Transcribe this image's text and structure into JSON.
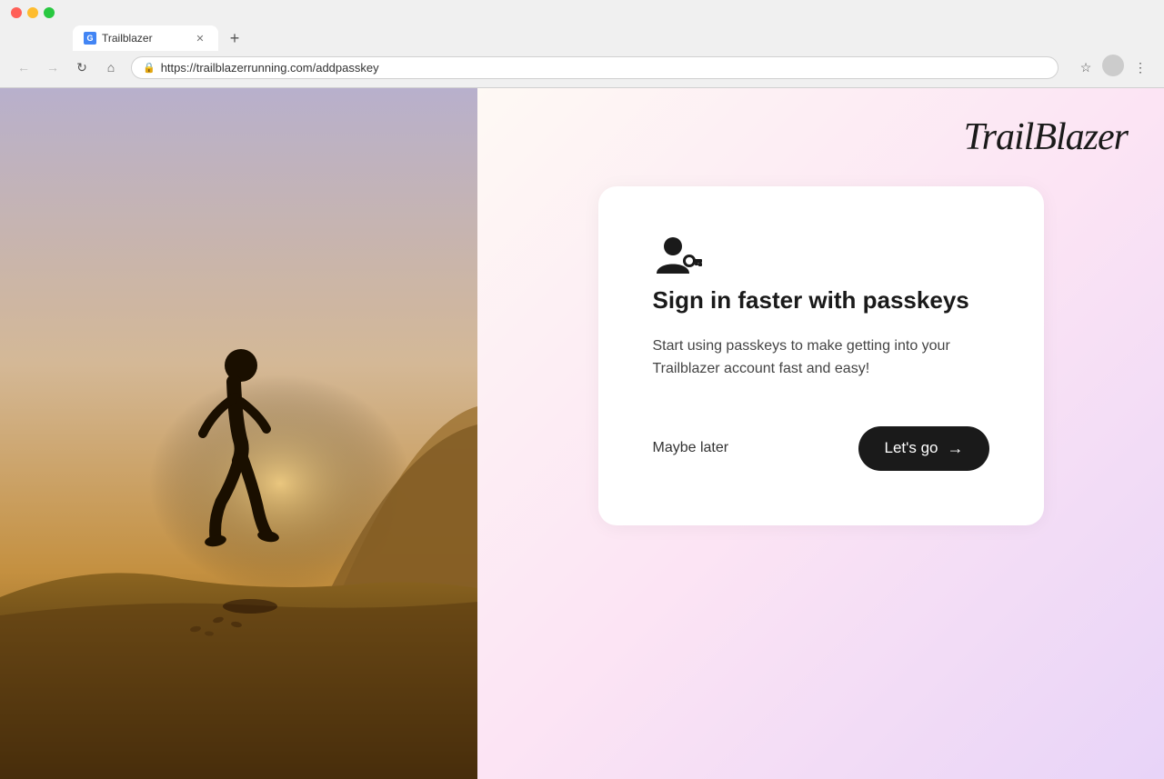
{
  "browser": {
    "tab_title": "Trailblazer",
    "tab_favicon_letter": "G",
    "url": "https://trailblazerrunning.com/addpasskey",
    "nav": {
      "back_label": "←",
      "forward_label": "→",
      "refresh_label": "↻",
      "home_label": "⌂"
    }
  },
  "logo": {
    "text": "TrailBlazer"
  },
  "card": {
    "title": "Sign in faster with passkeys",
    "description": "Start using passkeys to make getting into your Trailblazer account fast and easy!",
    "maybe_later_label": "Maybe later",
    "lets_go_label": "Let's go",
    "arrow": "→"
  },
  "colors": {
    "button_bg": "#1a1a1a",
    "button_text": "#ffffff",
    "card_bg": "#ffffff",
    "right_panel_start": "#fef9f4",
    "right_panel_end": "#e8d4f8"
  }
}
